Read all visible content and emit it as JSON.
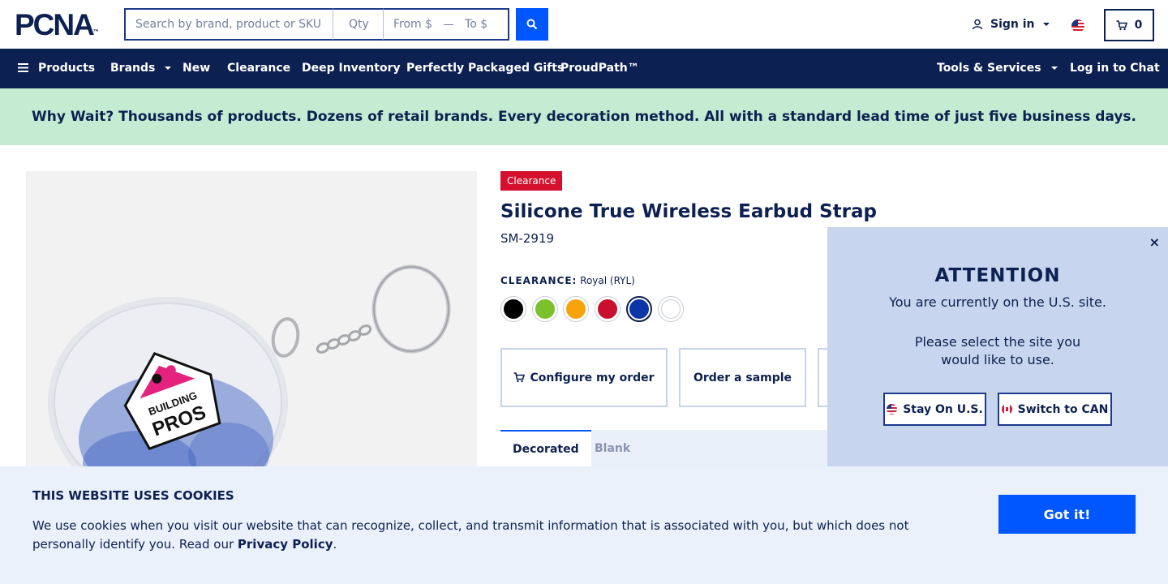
{
  "header": {
    "logo_text": "PCNA",
    "logo_mark": "™",
    "search_placeholder": "Search by brand, product or SKU",
    "qty_placeholder": "Qty",
    "price_from_placeholder": "From $",
    "price_to_placeholder": "To $",
    "signin_label": "Sign in",
    "cart_count": "0",
    "flag_country": "us-flag-icon"
  },
  "nav": {
    "products": "Products",
    "brands": "Brands",
    "new": "New",
    "clearance": "Clearance",
    "deep_inventory": "Deep Inventory",
    "gifts": "Perfectly Packaged Gifts",
    "proudpath": "ProudPath™",
    "tools": "Tools & Services",
    "chat": "Log in to Chat"
  },
  "banner": {
    "text": "Why Wait? Thousands of products. Dozens of retail brands. Every decoration method. All with a standard lead time of just five business days."
  },
  "product": {
    "badge": "Clearance",
    "title": "Silicone True Wireless Earbud Strap",
    "sku": "SM-2919",
    "color_label": "CLEARANCE:",
    "color_value": "Royal (RYL)",
    "swatches": [
      {
        "color": "#000000"
      },
      {
        "color": "#7bc12c"
      },
      {
        "color": "#f7a30a"
      },
      {
        "color": "#c8102e"
      },
      {
        "color": "#0c36a6",
        "selected": true
      },
      {
        "color": "#ffffff"
      }
    ],
    "configure_label": "Configure my order",
    "sample_label": "Order a sample",
    "tabs": [
      "Decorated",
      "Blank"
    ],
    "image_logo_text": "BUILDING PROS"
  },
  "popup": {
    "title": "ATTENTION",
    "line1": "You are currently on the U.S. site.",
    "line2": "Please select the site you",
    "line3": "would like to use.",
    "stay_label": "Stay On U.S.",
    "switch_label": "Switch to CAN",
    "close": "×"
  },
  "cookie": {
    "title": "THIS WEBSITE USES COOKIES",
    "text_before": "We use cookies when you visit our website that can recognize, collect, and transmit information that is associated with you, but which does not personally identify you. Read our ",
    "link": "Privacy Policy",
    "text_after": ".",
    "button": "Got it!"
  },
  "colors": {
    "navy": "#0c2051",
    "accent_blue": "#0057ff",
    "banner_green": "#c4ecd2",
    "clearance_red": "#d4102e",
    "popup_bg": "#c7d6ee",
    "cookie_bg": "#ebf1fb"
  }
}
